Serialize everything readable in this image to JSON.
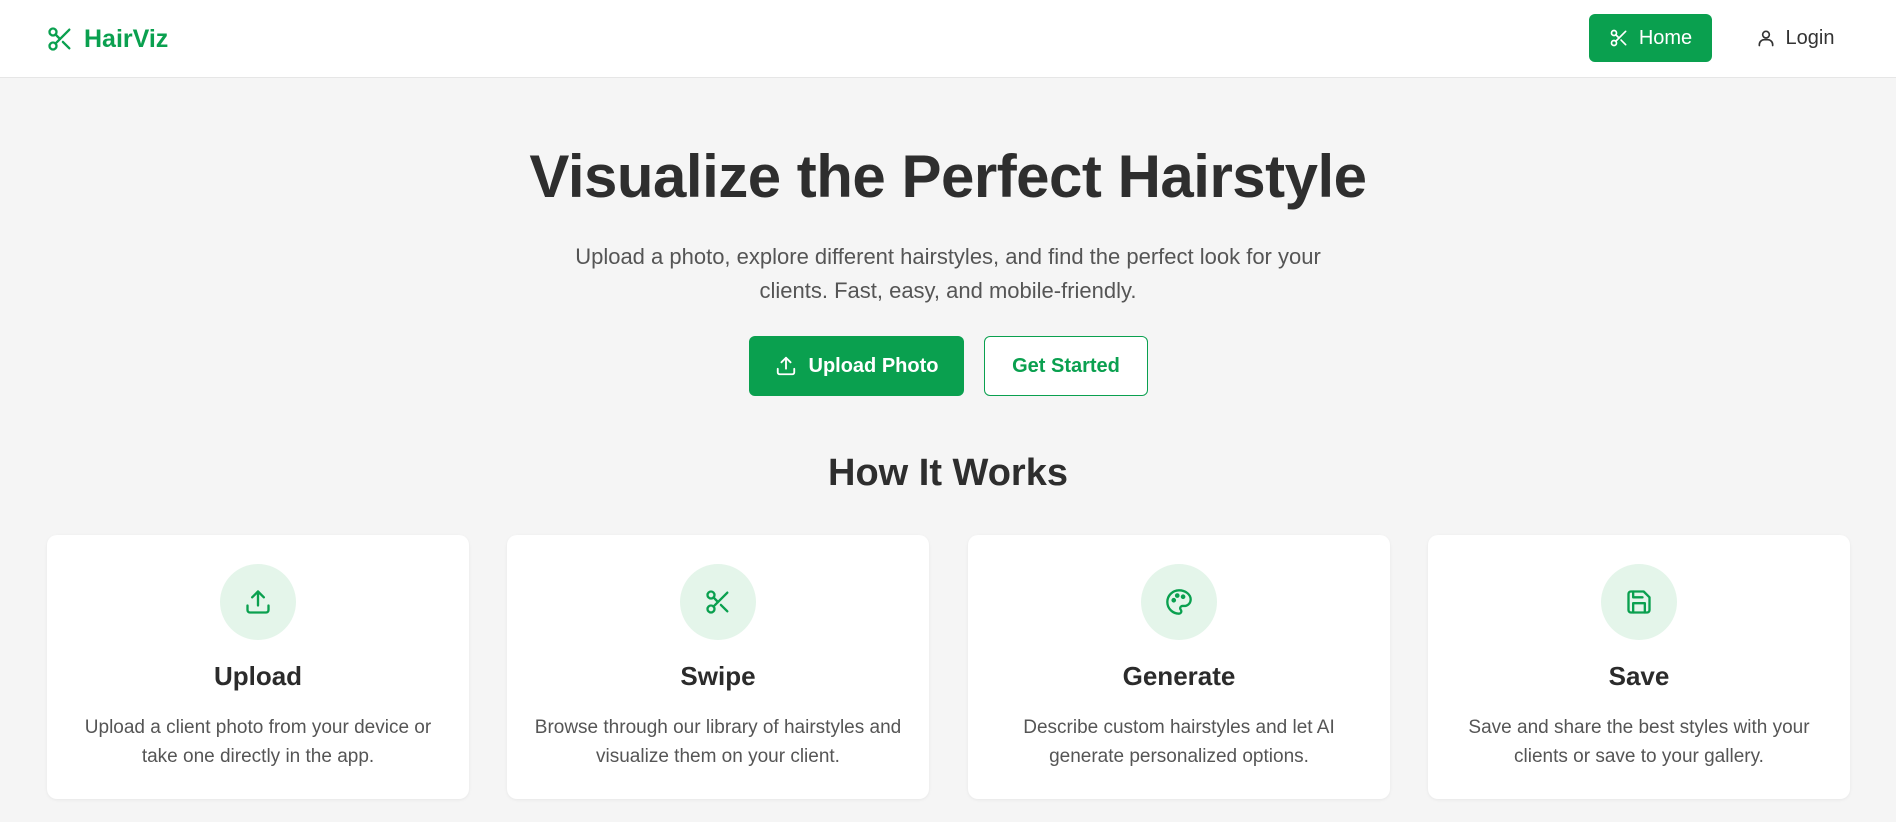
{
  "header": {
    "brand": "HairViz",
    "nav": {
      "home_label": "Home",
      "login_label": "Login"
    }
  },
  "hero": {
    "title": "Visualize the Perfect Hairstyle",
    "subtitle": "Upload a photo, explore different hairstyles, and find the perfect look for your clients. Fast, easy, and mobile-friendly.",
    "upload_label": "Upload Photo",
    "get_started_label": "Get Started"
  },
  "how_it_works": {
    "title": "How It Works",
    "steps": [
      {
        "icon": "upload-icon",
        "title": "Upload",
        "description": "Upload a client photo from your device or take one directly in the app."
      },
      {
        "icon": "scissors-icon",
        "title": "Swipe",
        "description": "Browse through our library of hairstyles and visualize them on your client."
      },
      {
        "icon": "palette-icon",
        "title": "Generate",
        "description": "Describe custom hairstyles and let AI generate personalized options."
      },
      {
        "icon": "save-icon",
        "title": "Save",
        "description": "Save and share the best styles with your clients or save to your gallery."
      }
    ]
  },
  "colors": {
    "accent": "#0aa04f",
    "accent_light": "#e4f5ea",
    "background": "#f5f5f5"
  }
}
